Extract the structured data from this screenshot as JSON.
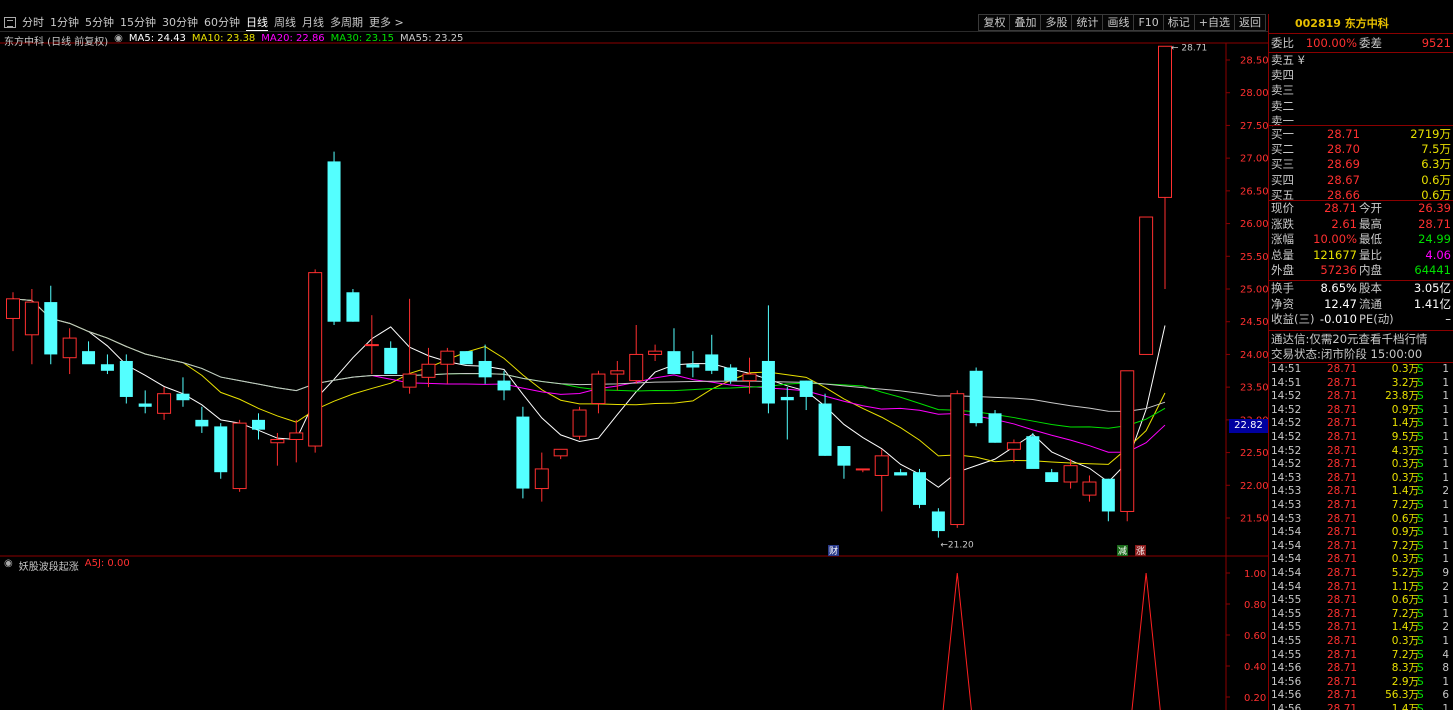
{
  "toolbar": {
    "periods": [
      "分时",
      "1分钟",
      "5分钟",
      "15分钟",
      "30分钟",
      "60分钟",
      "日线",
      "周线",
      "月线",
      "多周期",
      "更多 >"
    ],
    "active_period": "日线",
    "buttons": [
      "复权",
      "叠加",
      "多股",
      "统计",
      "画线",
      "F10",
      "标记",
      "+自选",
      "返回"
    ]
  },
  "legend": {
    "stock_title": "东方中科 (日线 前复权)",
    "ma5": "MA5: 24.43",
    "ma10": "MA10: 23.38",
    "ma20": "MA20: 22.86",
    "ma30": "MA30: 23.15",
    "ma55": "MA55: 23.25",
    "colors": {
      "ma5": "#ffffff",
      "ma10": "#e8e000",
      "ma20": "#ff00ff",
      "ma30": "#00e000",
      "ma55": "#c8c8c8"
    }
  },
  "indicator": {
    "name": "妖股波段起涨",
    "value": "A5J: 0.00",
    "ticks": [
      "1.00",
      "0.80",
      "0.60",
      "0.40",
      "0.20"
    ]
  },
  "price_axis": {
    "ticks": [
      "28.50",
      "28.00",
      "27.50",
      "27.00",
      "26.50",
      "26.00",
      "25.50",
      "25.00",
      "24.50",
      "24.00",
      "23.50",
      "23.00",
      "22.50",
      "22.00",
      "21.50"
    ],
    "current_tag": "22.82",
    "high_label": "28.71",
    "low_label": "21.20"
  },
  "markers": {
    "cai": "财",
    "jian": "减",
    "zhang": "涨"
  },
  "chart_data": {
    "type": "candlestick",
    "title": "东方中科 (日线 前复权)",
    "candles": [
      {
        "o": 24.55,
        "h": 24.95,
        "l": 24.05,
        "c": 24.85
      },
      {
        "o": 24.3,
        "h": 25.0,
        "l": 23.85,
        "c": 24.8
      },
      {
        "o": 24.8,
        "h": 25.05,
        "l": 23.85,
        "c": 24.0
      },
      {
        "o": 23.95,
        "h": 24.4,
        "l": 23.7,
        "c": 24.25
      },
      {
        "o": 24.05,
        "h": 24.2,
        "l": 23.95,
        "c": 23.85
      },
      {
        "o": 23.85,
        "h": 24.0,
        "l": 23.7,
        "c": 23.75
      },
      {
        "o": 23.9,
        "h": 24.0,
        "l": 23.25,
        "c": 23.35
      },
      {
        "o": 23.25,
        "h": 23.45,
        "l": 23.1,
        "c": 23.2
      },
      {
        "o": 23.1,
        "h": 23.5,
        "l": 23.0,
        "c": 23.4
      },
      {
        "o": 23.4,
        "h": 23.65,
        "l": 23.2,
        "c": 23.3
      },
      {
        "o": 23.0,
        "h": 23.2,
        "l": 22.8,
        "c": 22.9
      },
      {
        "o": 22.9,
        "h": 22.95,
        "l": 22.1,
        "c": 22.2
      },
      {
        "o": 21.95,
        "h": 23.0,
        "l": 21.9,
        "c": 22.95
      },
      {
        "o": 23.0,
        "h": 23.1,
        "l": 22.7,
        "c": 22.85
      },
      {
        "o": 22.65,
        "h": 22.8,
        "l": 22.3,
        "c": 22.7
      },
      {
        "o": 22.7,
        "h": 23.0,
        "l": 22.35,
        "c": 22.8
      },
      {
        "o": 22.6,
        "h": 25.3,
        "l": 22.5,
        "c": 25.25
      },
      {
        "o": 26.95,
        "h": 27.1,
        "l": 24.45,
        "c": 24.5
      },
      {
        "o": 24.95,
        "h": 25.0,
        "l": 24.5,
        "c": 24.5
      },
      {
        "o": 24.15,
        "h": 24.6,
        "l": 23.7,
        "c": 24.15
      },
      {
        "o": 24.1,
        "h": 24.2,
        "l": 23.7,
        "c": 23.7
      },
      {
        "o": 23.5,
        "h": 24.85,
        "l": 23.4,
        "c": 23.7
      },
      {
        "o": 23.65,
        "h": 24.1,
        "l": 23.5,
        "c": 23.85
      },
      {
        "o": 23.85,
        "h": 24.1,
        "l": 23.55,
        "c": 24.05
      },
      {
        "o": 24.05,
        "h": 24.05,
        "l": 23.85,
        "c": 23.85
      },
      {
        "o": 23.9,
        "h": 24.15,
        "l": 23.55,
        "c": 23.65
      },
      {
        "o": 23.6,
        "h": 23.75,
        "l": 23.3,
        "c": 23.45
      },
      {
        "o": 23.05,
        "h": 23.2,
        "l": 21.8,
        "c": 21.95
      },
      {
        "o": 21.95,
        "h": 22.5,
        "l": 21.75,
        "c": 22.25
      },
      {
        "o": 22.45,
        "h": 22.55,
        "l": 22.4,
        "c": 22.55
      },
      {
        "o": 22.75,
        "h": 23.2,
        "l": 22.7,
        "c": 23.15
      },
      {
        "o": 23.25,
        "h": 23.75,
        "l": 23.1,
        "c": 23.7
      },
      {
        "o": 23.7,
        "h": 23.9,
        "l": 23.45,
        "c": 23.75
      },
      {
        "o": 23.6,
        "h": 24.45,
        "l": 23.55,
        "c": 24.0
      },
      {
        "o": 24.0,
        "h": 24.15,
        "l": 23.9,
        "c": 24.05
      },
      {
        "o": 24.05,
        "h": 24.4,
        "l": 23.85,
        "c": 23.7
      },
      {
        "o": 23.85,
        "h": 24.05,
        "l": 23.65,
        "c": 23.8
      },
      {
        "o": 24.0,
        "h": 24.3,
        "l": 23.7,
        "c": 23.75
      },
      {
        "o": 23.8,
        "h": 23.85,
        "l": 23.55,
        "c": 23.6
      },
      {
        "o": 23.6,
        "h": 23.95,
        "l": 23.4,
        "c": 23.7
      },
      {
        "o": 23.9,
        "h": 24.75,
        "l": 23.1,
        "c": 23.25
      },
      {
        "o": 23.35,
        "h": 23.5,
        "l": 22.7,
        "c": 23.3
      },
      {
        "o": 23.6,
        "h": 23.6,
        "l": 23.15,
        "c": 23.35
      },
      {
        "o": 23.25,
        "h": 23.4,
        "l": 22.45,
        "c": 22.45
      },
      {
        "o": 22.6,
        "h": 22.6,
        "l": 22.1,
        "c": 22.3
      },
      {
        "o": 22.25,
        "h": 22.25,
        "l": 22.2,
        "c": 22.25
      },
      {
        "o": 22.15,
        "h": 22.55,
        "l": 21.6,
        "c": 22.45
      },
      {
        "o": 22.2,
        "h": 22.25,
        "l": 22.15,
        "c": 22.15
      },
      {
        "o": 22.2,
        "h": 22.25,
        "l": 21.65,
        "c": 21.7
      },
      {
        "o": 21.6,
        "h": 21.65,
        "l": 21.2,
        "c": 21.3
      },
      {
        "o": 21.4,
        "h": 23.45,
        "l": 21.35,
        "c": 23.4
      },
      {
        "o": 23.75,
        "h": 23.8,
        "l": 22.9,
        "c": 22.95
      },
      {
        "o": 23.1,
        "h": 23.15,
        "l": 22.65,
        "c": 22.65
      },
      {
        "o": 22.55,
        "h": 22.7,
        "l": 22.35,
        "c": 22.65
      },
      {
        "o": 22.75,
        "h": 22.8,
        "l": 22.3,
        "c": 22.25
      },
      {
        "o": 22.2,
        "h": 22.25,
        "l": 22.05,
        "c": 22.05
      },
      {
        "o": 22.05,
        "h": 22.4,
        "l": 21.95,
        "c": 22.3
      },
      {
        "o": 21.85,
        "h": 22.15,
        "l": 21.75,
        "c": 22.05
      },
      {
        "o": 22.1,
        "h": 22.1,
        "l": 21.45,
        "c": 21.6
      },
      {
        "o": 21.6,
        "h": 23.75,
        "l": 21.45,
        "c": 23.75
      },
      {
        "o": 24.0,
        "h": 26.1,
        "l": 24.0,
        "c": 26.1
      },
      {
        "o": 26.4,
        "h": 28.71,
        "l": 25.0,
        "c": 28.71
      }
    ],
    "ylim": [
      21.15,
      28.85
    ],
    "indicator_spikes": [
      50,
      60
    ]
  },
  "panel": {
    "code_name": "002819 东方中科",
    "weibi": {
      "label": "委比",
      "value": "100.00%",
      "label2": "委差",
      "value2": "9521"
    },
    "sell": [
      {
        "label": "卖五 ¥",
        "price": "",
        "vol": ""
      },
      {
        "label": "卖四",
        "price": "",
        "vol": ""
      },
      {
        "label": "卖三",
        "price": "",
        "vol": ""
      },
      {
        "label": "卖二",
        "price": "",
        "vol": ""
      },
      {
        "label": "卖一",
        "price": "",
        "vol": ""
      }
    ],
    "buy": [
      {
        "label": "买一",
        "price": "28.71",
        "vol": "2719万"
      },
      {
        "label": "买二",
        "price": "28.70",
        "vol": "7.5万"
      },
      {
        "label": "买三",
        "price": "28.69",
        "vol": "6.3万"
      },
      {
        "label": "买四",
        "price": "28.67",
        "vol": "0.6万"
      },
      {
        "label": "买五",
        "price": "28.66",
        "vol": "0.6万"
      }
    ],
    "stats": [
      {
        "l1": "现价",
        "v1": "28.71",
        "c1": "red",
        "l2": "今开",
        "v2": "26.39",
        "c2": "red"
      },
      {
        "l1": "涨跌",
        "v1": "2.61",
        "c1": "red",
        "l2": "最高",
        "v2": "28.71",
        "c2": "red"
      },
      {
        "l1": "涨幅",
        "v1": "10.00%",
        "c1": "red",
        "l2": "最低",
        "v2": "24.99",
        "c2": "green"
      },
      {
        "l1": "总量",
        "v1": "121677",
        "c1": "yellow",
        "l2": "量比",
        "v2": "4.06",
        "c2": "magenta"
      },
      {
        "l1": "外盘",
        "v1": "57236",
        "c1": "red",
        "l2": "内盘",
        "v2": "64441",
        "c2": "green"
      }
    ],
    "stats2": [
      {
        "l1": "换手",
        "v1": "8.65%",
        "c1": "white",
        "l2": "股本",
        "v2": "3.05亿",
        "c2": "white"
      },
      {
        "l1": "净资",
        "v1": "12.47",
        "c1": "white",
        "l2": "流通",
        "v2": "1.41亿",
        "c2": "white"
      },
      {
        "l1": "收益(三)",
        "v1": "-0.010",
        "c1": "white",
        "l2": "PE(动)",
        "v2": "–",
        "c2": "white"
      }
    ],
    "notice": "通达信:仅需20元查看千档行情",
    "status": "交易状态:闭市阶段 15:00:00",
    "trades": [
      {
        "t": "14:51",
        "p": "28.71",
        "v": "0.3万",
        "bs": "S",
        "n": "1"
      },
      {
        "t": "14:51",
        "p": "28.71",
        "v": "3.2万",
        "bs": "S",
        "n": "1"
      },
      {
        "t": "14:52",
        "p": "28.71",
        "v": "23.8万",
        "bs": "S",
        "n": "1"
      },
      {
        "t": "14:52",
        "p": "28.71",
        "v": "0.9万",
        "bs": "S",
        "n": "1"
      },
      {
        "t": "14:52",
        "p": "28.71",
        "v": "1.4万",
        "bs": "S",
        "n": "1"
      },
      {
        "t": "14:52",
        "p": "28.71",
        "v": "9.5万",
        "bs": "S",
        "n": "1"
      },
      {
        "t": "14:52",
        "p": "28.71",
        "v": "4.3万",
        "bs": "S",
        "n": "1"
      },
      {
        "t": "14:52",
        "p": "28.71",
        "v": "0.3万",
        "bs": "S",
        "n": "1"
      },
      {
        "t": "14:53",
        "p": "28.71",
        "v": "0.3万",
        "bs": "S",
        "n": "1"
      },
      {
        "t": "14:53",
        "p": "28.71",
        "v": "1.4万",
        "bs": "S",
        "n": "2"
      },
      {
        "t": "14:53",
        "p": "28.71",
        "v": "7.2万",
        "bs": "S",
        "n": "1"
      },
      {
        "t": "14:53",
        "p": "28.71",
        "v": "0.6万",
        "bs": "S",
        "n": "1"
      },
      {
        "t": "14:54",
        "p": "28.71",
        "v": "0.9万",
        "bs": "S",
        "n": "1"
      },
      {
        "t": "14:54",
        "p": "28.71",
        "v": "7.2万",
        "bs": "S",
        "n": "1"
      },
      {
        "t": "14:54",
        "p": "28.71",
        "v": "0.3万",
        "bs": "S",
        "n": "1"
      },
      {
        "t": "14:54",
        "p": "28.71",
        "v": "5.2万",
        "bs": "S",
        "n": "9"
      },
      {
        "t": "14:54",
        "p": "28.71",
        "v": "1.1万",
        "bs": "S",
        "n": "2"
      },
      {
        "t": "14:55",
        "p": "28.71",
        "v": "0.6万",
        "bs": "S",
        "n": "1"
      },
      {
        "t": "14:55",
        "p": "28.71",
        "v": "7.2万",
        "bs": "S",
        "n": "1"
      },
      {
        "t": "14:55",
        "p": "28.71",
        "v": "1.4万",
        "bs": "S",
        "n": "2"
      },
      {
        "t": "14:55",
        "p": "28.71",
        "v": "0.3万",
        "bs": "S",
        "n": "1"
      },
      {
        "t": "14:55",
        "p": "28.71",
        "v": "7.2万",
        "bs": "S",
        "n": "4"
      },
      {
        "t": "14:56",
        "p": "28.71",
        "v": "8.3万",
        "bs": "S",
        "n": "8"
      },
      {
        "t": "14:56",
        "p": "28.71",
        "v": "2.9万",
        "bs": "S",
        "n": "1"
      },
      {
        "t": "14:56",
        "p": "28.71",
        "v": "56.3万",
        "bs": "S",
        "n": "6"
      },
      {
        "t": "14:56",
        "p": "28.71",
        "v": "1.4万",
        "bs": "S",
        "n": "1"
      }
    ]
  }
}
